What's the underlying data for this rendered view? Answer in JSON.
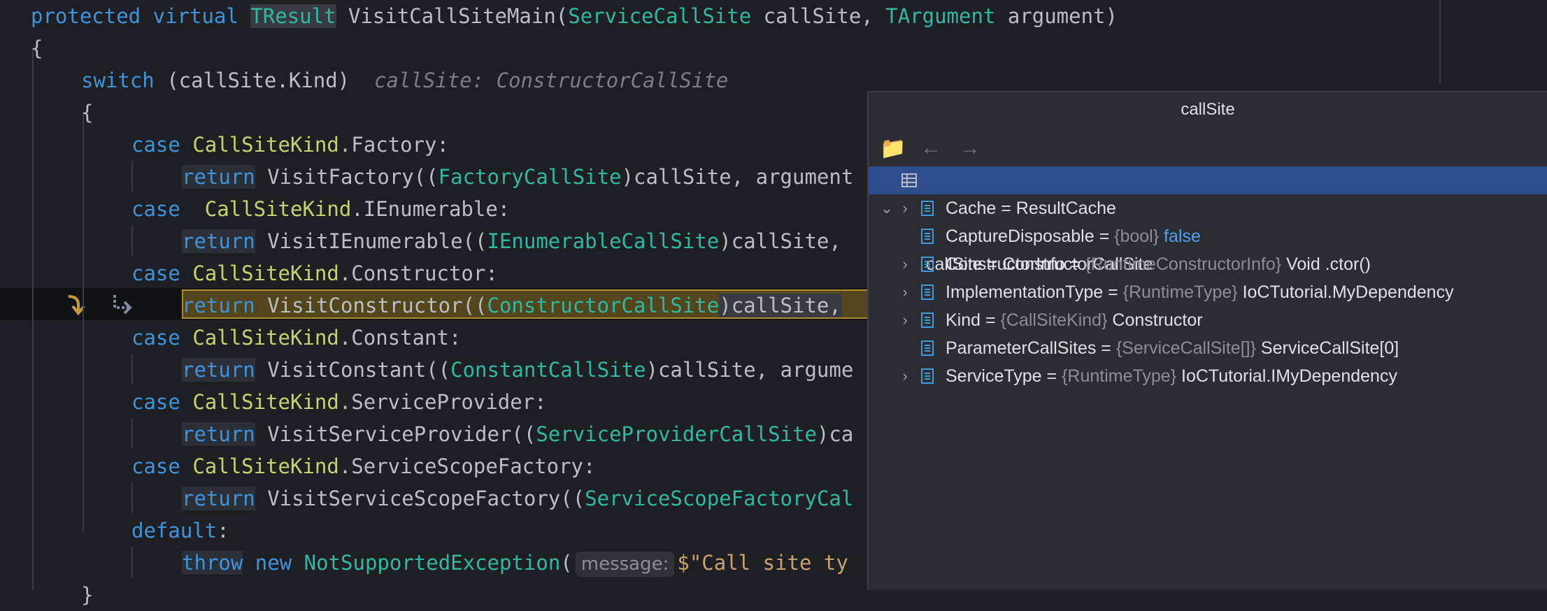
{
  "editor": {
    "line1": {
      "kw1": "protected",
      "kw2": "virtual",
      "type1": "TResult",
      "method": "VisitCallSiteMain(",
      "type2": "ServiceCallSite",
      "param1": " callSite, ",
      "type3": "TArgument",
      "param2": " argument)"
    },
    "line2": "{",
    "line3": {
      "kw": "switch",
      "rest": " (callSite.Kind)",
      "hint": "callSite: ConstructorCallSite"
    },
    "line4": "{",
    "cases": [
      {
        "case": "case",
        "sp": " ",
        "enum": "CallSiteKind",
        "member": ".Factory:",
        "ret": "return",
        "call": " VisitFactory((",
        "type": "FactoryCallSite",
        "tail": ")callSite, argument"
      },
      {
        "case": "case",
        "sp": "  ",
        "enum": "CallSiteKind",
        "member": ".IEnumerable:",
        "ret": "return",
        "call": " VisitIEnumerable((",
        "type": "IEnumerableCallSite",
        "tail": ")callSite, "
      },
      {
        "case": "case",
        "sp": " ",
        "enum": "CallSiteKind",
        "member": ".Constructor:",
        "ret": "return",
        "call": " VisitConstructor((",
        "type": "ConstructorCallSite",
        "tail": ")callSite,"
      },
      {
        "case": "case",
        "sp": " ",
        "enum": "CallSiteKind",
        "member": ".Constant:",
        "ret": "return",
        "call": " VisitConstant((",
        "type": "ConstantCallSite",
        "tail": ")callSite, argume"
      },
      {
        "case": "case",
        "sp": " ",
        "enum": "CallSiteKind",
        "member": ".ServiceProvider:",
        "ret": "return",
        "call": " VisitServiceProvider((",
        "type": "ServiceProviderCallSite",
        "tail": ")ca"
      },
      {
        "case": "case",
        "sp": " ",
        "enum": "CallSiteKind",
        "member": ".ServiceScopeFactory:",
        "ret": "return",
        "call": " VisitServiceScopeFactory((",
        "type": "ServiceScopeFactoryCal",
        "tail": ""
      }
    ],
    "default": {
      "kw": "default",
      "colon": ":"
    },
    "throw": {
      "kw1": "throw",
      "kw2": "new",
      "type": "NotSupportedException",
      "paren": "(",
      "hint": "message:",
      "str": "$\"Call site ty"
    },
    "close_brace": "}"
  },
  "popup": {
    "title": "callSite",
    "root": {
      "name": "callSite",
      "eq": " = ",
      "value": "ConstructorCallSite"
    },
    "items": [
      {
        "name": "Cache",
        "eq": " = ",
        "type": "",
        "value": "ResultCache",
        "expandable": true,
        "vclass": ""
      },
      {
        "name": "CaptureDisposable",
        "eq": " = ",
        "type": "{bool}",
        "value": "false",
        "expandable": false,
        "vclass": "vkw"
      },
      {
        "name": "ConstructorInfo",
        "eq": " = ",
        "type": "{RuntimeConstructorInfo}",
        "value": "Void .ctor()",
        "expandable": true,
        "vclass": ""
      },
      {
        "name": "ImplementationType",
        "eq": " = ",
        "type": "{RuntimeType}",
        "value": "IoCTutorial.MyDependency",
        "expandable": true,
        "vclass": ""
      },
      {
        "name": "Kind",
        "eq": " = ",
        "type": "{CallSiteKind}",
        "value": "Constructor",
        "expandable": true,
        "vclass": ""
      },
      {
        "name": "ParameterCallSites",
        "eq": " = ",
        "type": "{ServiceCallSite[]}",
        "value": "ServiceCallSite[0]",
        "expandable": false,
        "vclass": ""
      },
      {
        "name": "ServiceType",
        "eq": " = ",
        "type": "{RuntimeType}",
        "value": "IoCTutorial.IMyDependency",
        "expandable": true,
        "vclass": ""
      }
    ]
  }
}
